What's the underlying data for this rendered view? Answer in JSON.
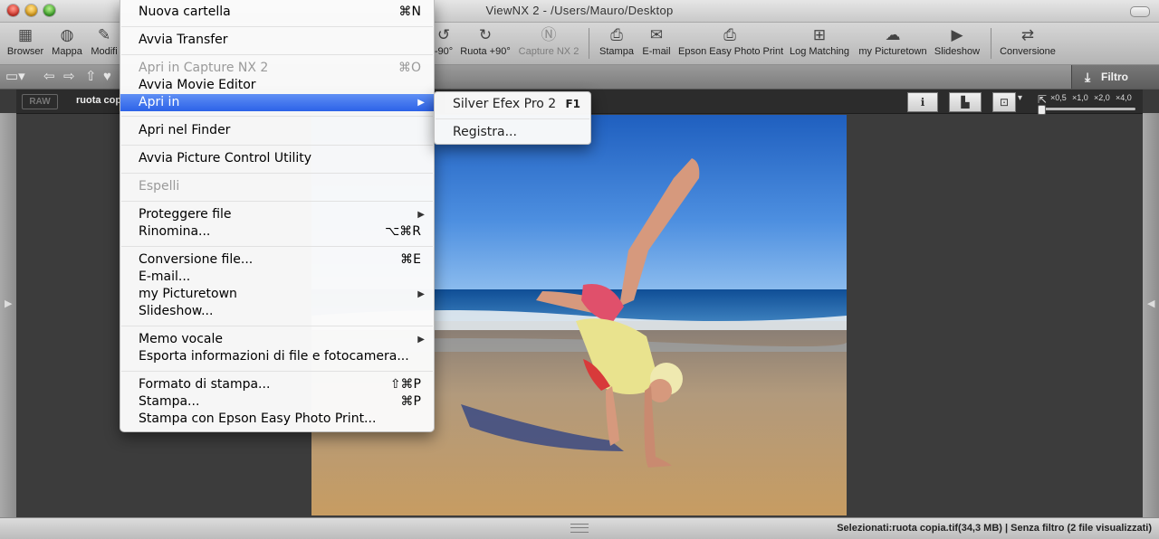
{
  "window": {
    "title": "ViewNX 2 - /Users/Mauro/Desktop"
  },
  "toolbar": [
    {
      "label": "Browser",
      "icon": "browser-icon",
      "glyph": "▦",
      "enabled": true
    },
    {
      "label": "Mappa",
      "icon": "globe-icon",
      "glyph": "◍",
      "enabled": true
    },
    {
      "label": "Modifi",
      "icon": "edit-icon",
      "glyph": "✎",
      "enabled": true
    },
    {
      "label": "-90°",
      "icon": "rotate-left-icon",
      "glyph": "↺",
      "enabled": true
    },
    {
      "label": "Ruota +90°",
      "icon": "rotate-right-icon",
      "glyph": "↻",
      "enabled": true
    },
    {
      "label": "Capture NX 2",
      "icon": "capture-nx-icon",
      "glyph": "Ⓝ",
      "enabled": false
    },
    {
      "label": "Stampa",
      "icon": "printer-icon",
      "glyph": "⎙",
      "enabled": true
    },
    {
      "label": "E-mail",
      "icon": "envelope-icon",
      "glyph": "✉",
      "enabled": true
    },
    {
      "label": "Epson Easy Photo Print",
      "icon": "epson-printer-icon",
      "glyph": "⎙",
      "enabled": true
    },
    {
      "label": "Log Matching",
      "icon": "log-matching-icon",
      "glyph": "⊞",
      "enabled": true
    },
    {
      "label": "my Picturetown",
      "icon": "picturetown-icon",
      "glyph": "☁",
      "enabled": true
    },
    {
      "label": "Slideshow",
      "icon": "slideshow-icon",
      "glyph": "▶",
      "enabled": true
    },
    {
      "label": "Conversione",
      "icon": "conversion-icon",
      "glyph": "⇄",
      "enabled": true
    }
  ],
  "filter": {
    "label": "Filtro",
    "icon": "download-icon"
  },
  "viewer": {
    "raw_badge": "RAW",
    "file_label": "ruota copia",
    "zoom_levels": [
      "×0,5",
      "×1,0",
      "×2,0",
      "×4,0"
    ]
  },
  "status": {
    "text": "Selezionati:ruota copia.tif(34,3 MB) | Senza filtro (2 file visualizzati)"
  },
  "menu": {
    "items": [
      {
        "label": "Nuova cartella",
        "shortcut": "⌘N"
      },
      {
        "label": "Avvia Transfer"
      },
      {
        "label": "Apri in Capture NX 2",
        "shortcut": "⌘O",
        "disabled": true
      },
      {
        "label": "Avvia Movie Editor"
      },
      {
        "label": "Apri in",
        "submenu": true,
        "selected": true
      },
      {
        "label": "Apri nel Finder"
      },
      {
        "label": "Avvia Picture Control Utility"
      },
      {
        "label": "Espelli",
        "disabled": true
      },
      {
        "label": "Proteggere file",
        "submenu": true
      },
      {
        "label": "Rinomina...",
        "shortcut": "⌥⌘R"
      },
      {
        "label": "Conversione file...",
        "shortcut": "⌘E"
      },
      {
        "label": "E-mail..."
      },
      {
        "label": "my Picturetown",
        "submenu": true
      },
      {
        "label": "Slideshow..."
      },
      {
        "label": "Memo vocale",
        "submenu": true
      },
      {
        "label": "Esporta informazioni di file e fotocamera..."
      },
      {
        "label": "Formato di stampa...",
        "shortcut": "⇧⌘P"
      },
      {
        "label": "Stampa...",
        "shortcut": "⌘P"
      },
      {
        "label": "Stampa con Epson Easy Photo Print..."
      }
    ]
  },
  "submenu": {
    "items": [
      {
        "label": "Silver Efex Pro 2",
        "shortcut": "F1"
      },
      {
        "label": "Registra..."
      }
    ]
  }
}
